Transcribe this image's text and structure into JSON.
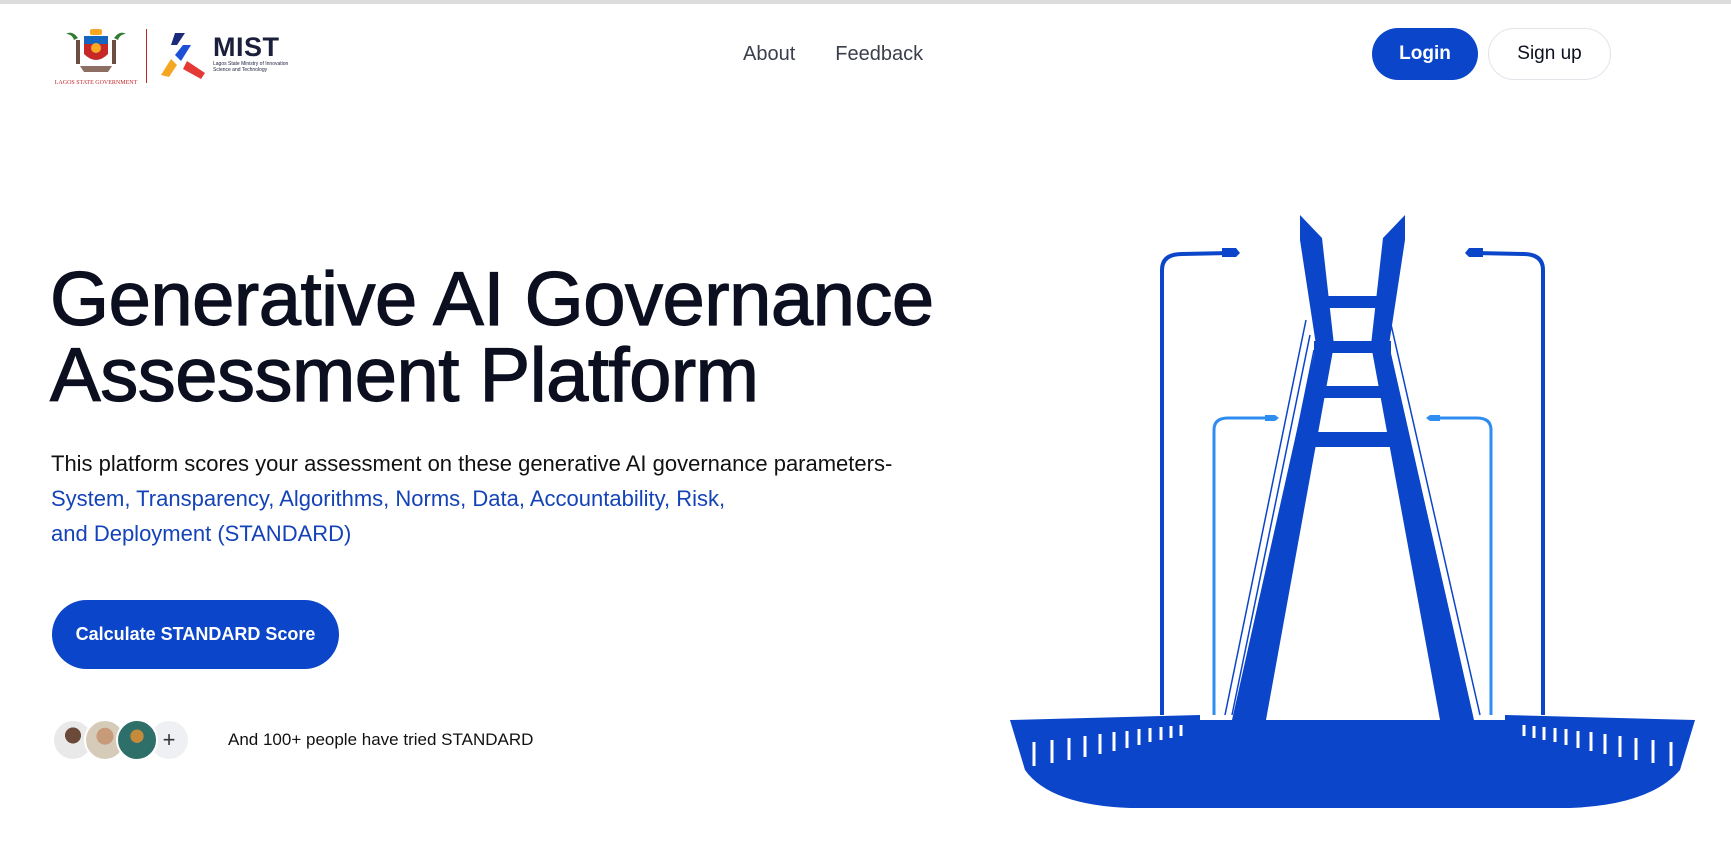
{
  "header": {
    "logos": {
      "lagos_caption": "LAGOS STATE GOVERNMENT",
      "mist_name": "MIST",
      "mist_tagline_line1": "Lagos State Ministry of Innovation",
      "mist_tagline_line2": "Science and Technology"
    },
    "nav": [
      {
        "label": "About"
      },
      {
        "label": "Feedback"
      }
    ],
    "login_label": "Login",
    "signup_label": "Sign up"
  },
  "hero": {
    "title_line1": "Generative AI Governance",
    "title_line2": "Assessment Platform",
    "description_intro": "This platform scores your assessment on these generative AI governance parameters-",
    "description_params_line1": "System, Transparency, Algorithms, Norms, Data, Accountability, Risk,",
    "description_params_line2": "and Deployment (STANDARD)",
    "cta_label": "Calculate STANDARD Score",
    "social_proof": "And 100+ people have tried STANDARD",
    "avatar_more": "+"
  },
  "colors": {
    "primary": "#0b45c9",
    "accent_text": "#1443b8",
    "light_blue": "#2f8df0"
  }
}
